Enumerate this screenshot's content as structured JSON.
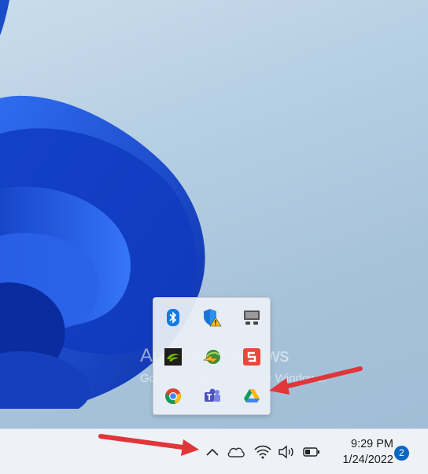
{
  "watermark": {
    "line1": "Activate Windows",
    "line2": "Go to Settings to activate Windows."
  },
  "tray_overflow": {
    "icons": [
      {
        "name": "bluetooth-icon"
      },
      {
        "name": "windows-security-warning-icon"
      },
      {
        "name": "display-icon"
      },
      {
        "name": "nvidia-icon"
      },
      {
        "name": "internet-download-manager-icon"
      },
      {
        "name": "snagit-icon"
      },
      {
        "name": "chrome-icon"
      },
      {
        "name": "teams-icon"
      },
      {
        "name": "google-drive-icon"
      }
    ]
  },
  "taskbar": {
    "icons": [
      "chevron-up-icon",
      "onedrive-cloud-icon",
      "wifi-icon",
      "volume-icon",
      "battery-icon"
    ],
    "clock": {
      "time": "9:29 PM",
      "date": "1/24/2022"
    },
    "notification_count": "2"
  },
  "colors": {
    "accent": "#0a67c2",
    "arrow": "#e0363a",
    "wallpaper_blue": "#1a4fd6"
  }
}
